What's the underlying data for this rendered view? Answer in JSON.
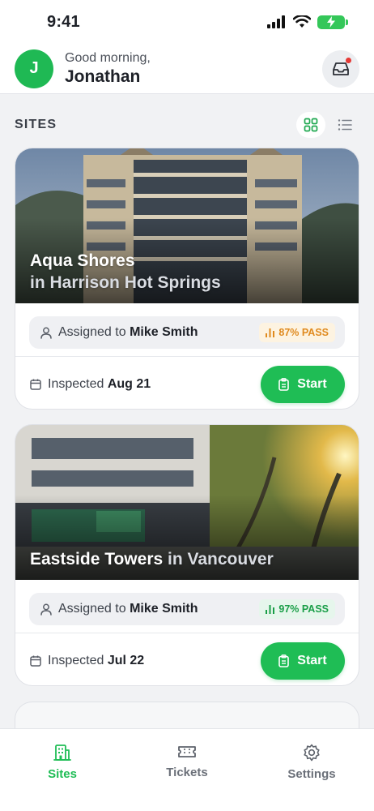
{
  "status_bar": {
    "time": "9:41"
  },
  "header": {
    "avatar_initial": "J",
    "greeting": "Good morning,",
    "user_name": "Jonathan",
    "inbox_icon": "inbox-icon",
    "inbox_has_notification": true
  },
  "sites_section": {
    "title": "SITES",
    "view_modes": [
      "grid",
      "list"
    ],
    "active_view": "grid"
  },
  "sites": [
    {
      "name": "Aqua Shores",
      "location": "in Harrison Hot Springs",
      "assigned_prefix": "Assigned to",
      "assignee": "Mike Smith",
      "pass_rate": "87% PASS",
      "pass_color": "#e08a1e",
      "pass_bg": "#fdf3e1",
      "inspected_prefix": "Inspected",
      "inspected_date": "Aug 21",
      "start_label": "Start"
    },
    {
      "name": "Eastside Towers",
      "location": "in Vancouver",
      "assigned_prefix": "Assigned to",
      "assignee": "Mike Smith",
      "pass_rate": "97% PASS",
      "pass_color": "#1a9e48",
      "pass_bg": "#e6f6ec",
      "inspected_prefix": "Inspected",
      "inspected_date": "Jul 22",
      "start_label": "Start"
    }
  ],
  "tabbar": {
    "tabs": [
      {
        "label": "Sites",
        "icon": "building-icon",
        "active": true
      },
      {
        "label": "Tickets",
        "icon": "ticket-icon",
        "active": false
      },
      {
        "label": "Settings",
        "icon": "gear-icon",
        "active": false
      }
    ]
  },
  "colors": {
    "accent": "#1fbd55",
    "background": "#f1f2f4"
  }
}
